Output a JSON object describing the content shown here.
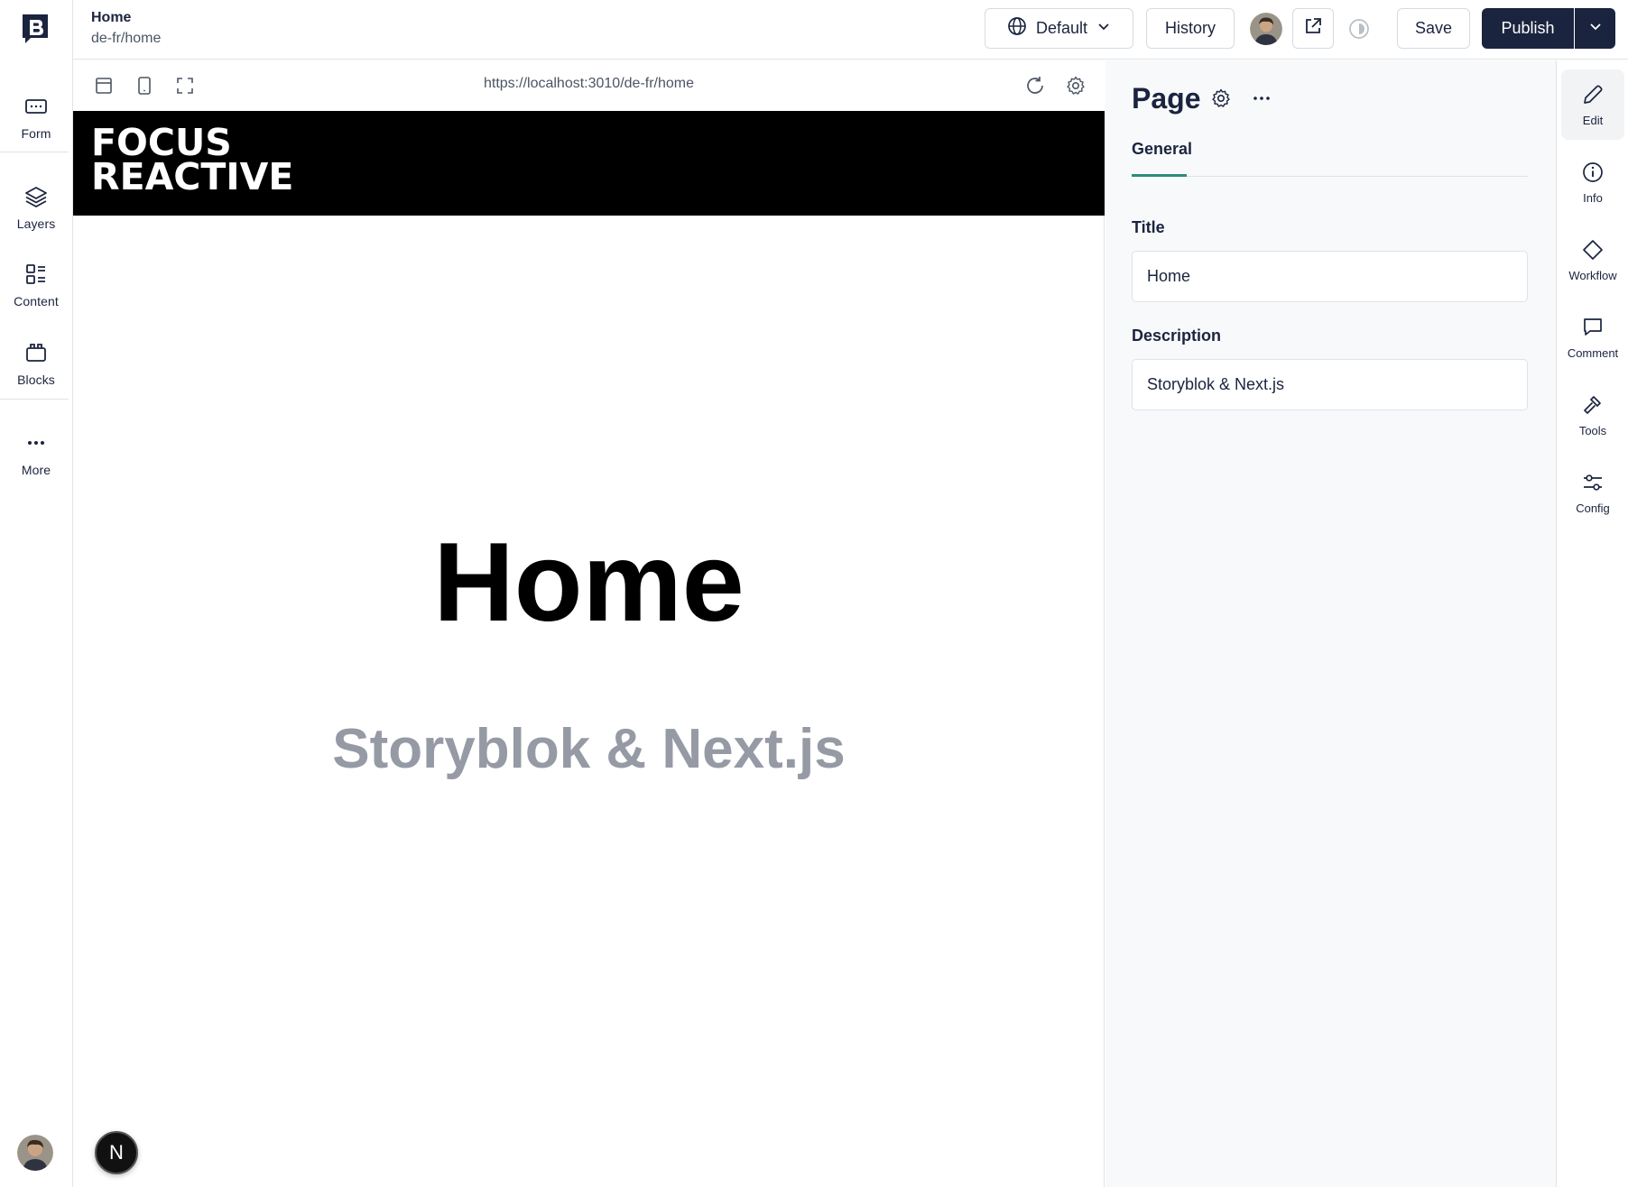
{
  "left_rail": {
    "items": [
      {
        "label": "Form",
        "icon": "form-icon"
      },
      {
        "label": "Layers",
        "icon": "layers-icon"
      },
      {
        "label": "Content",
        "icon": "content-icon"
      },
      {
        "label": "Blocks",
        "icon": "blocks-icon"
      },
      {
        "label": "More",
        "icon": "more-icon"
      }
    ]
  },
  "topbar": {
    "page_name": "Home",
    "page_slug": "de-fr/home",
    "language_label": "Default",
    "history_label": "History",
    "save_label": "Save",
    "publish_label": "Publish"
  },
  "preview": {
    "url": "https://localhost:3010/de-fr/home",
    "logo_line1": "FOCUS",
    "logo_line2": "REACTIVE",
    "hero_title": "Home",
    "hero_subtitle": "Storyblok & Next.js",
    "badge_letter": "N"
  },
  "panel": {
    "title": "Page",
    "tab_general": "General",
    "title_label": "Title",
    "title_value": "Home",
    "description_label": "Description",
    "description_value": "Storyblok & Next.js"
  },
  "right_rail": {
    "items": [
      {
        "label": "Edit",
        "icon": "pencil-icon",
        "active": true
      },
      {
        "label": "Info",
        "icon": "info-icon"
      },
      {
        "label": "Workflow",
        "icon": "diamond-icon"
      },
      {
        "label": "Comment",
        "icon": "comment-icon"
      },
      {
        "label": "Tools",
        "icon": "hammer-icon"
      },
      {
        "label": "Config",
        "icon": "sliders-icon"
      }
    ]
  },
  "colors": {
    "primary": "#1b243f",
    "accent_tab": "#2e8b7a",
    "hero_subtitle": "#959aa5"
  }
}
